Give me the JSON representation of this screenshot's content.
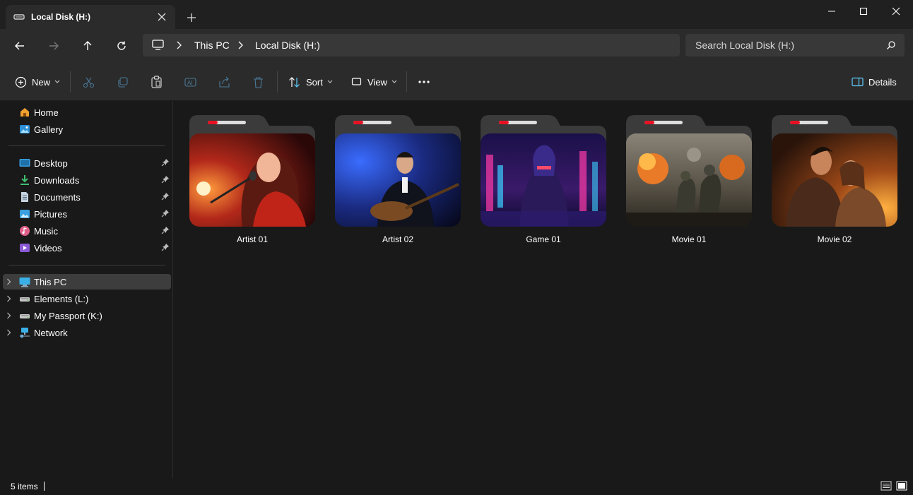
{
  "window": {
    "tab_title": "Local Disk (H:)",
    "tab_icon": "drive-icon"
  },
  "address": {
    "breadcrumbs": [
      "This PC",
      "Local Disk (H:)"
    ],
    "search_placeholder": "Search Local Disk (H:)"
  },
  "commands": {
    "new_label": "New",
    "sort_label": "Sort",
    "view_label": "View",
    "details_label": "Details"
  },
  "sidebar": {
    "quick": [
      {
        "label": "Home",
        "icon": "home-icon"
      },
      {
        "label": "Gallery",
        "icon": "gallery-icon"
      }
    ],
    "pinned": [
      {
        "label": "Desktop",
        "icon": "desktop-icon"
      },
      {
        "label": "Downloads",
        "icon": "downloads-icon"
      },
      {
        "label": "Documents",
        "icon": "documents-icon"
      },
      {
        "label": "Pictures",
        "icon": "pictures-icon"
      },
      {
        "label": "Music",
        "icon": "music-icon"
      },
      {
        "label": "Videos",
        "icon": "videos-icon"
      }
    ],
    "devices": [
      {
        "label": "This PC",
        "icon": "this-pc-icon",
        "selected": true
      },
      {
        "label": "Elements (L:)",
        "icon": "drive-icon"
      },
      {
        "label": "My Passport (K:)",
        "icon": "drive-icon"
      },
      {
        "label": "Network",
        "icon": "network-icon"
      }
    ]
  },
  "folders": [
    {
      "name": "Artist 01"
    },
    {
      "name": "Artist 02"
    },
    {
      "name": "Game 01"
    },
    {
      "name": "Movie 01"
    },
    {
      "name": "Movie 02"
    }
  ],
  "status": {
    "item_count": "5 items"
  },
  "colors": {
    "accent": "#60cdff",
    "folder_tab_red": "#e81123",
    "selected_bg": "#3d3d3d"
  }
}
